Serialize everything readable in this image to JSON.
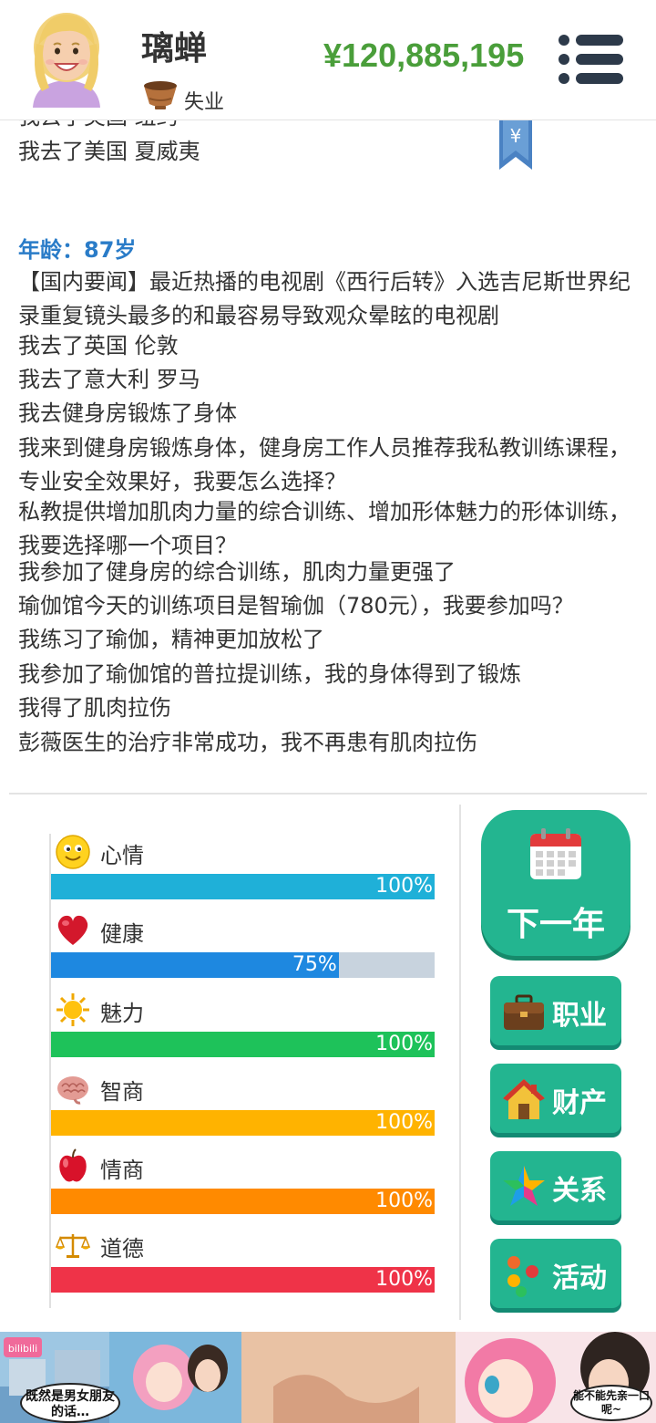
{
  "header": {
    "name": "璃蝉",
    "job": "失业",
    "money": "¥120,885,195"
  },
  "log": {
    "cut_line": "我去了美国 纽约",
    "top_line": "我去了美国 夏威夷",
    "age": "年龄：87岁",
    "entries": [
      "【国内要闻】最近热播的电视剧《西行后转》入选吉尼斯世界纪录重复镜头最多的和最容易导致观众晕眩的电视剧",
      "我去了英国 伦敦",
      "我去了意大利 罗马",
      "我去健身房锻炼了身体",
      "我来到健身房锻炼身体，健身房工作人员推荐我私教训练课程，专业安全效果好，我要怎么选择？",
      "私教提供增加肌肉力量的综合训练、增加形体魅力的形体训练，我要选择哪一个项目？",
      "我参加了健身房的综合训练，肌肉力量更强了",
      "瑜伽馆今天的训练项目是智瑜伽（780元），我要参加吗？",
      "我练习了瑜伽，精神更加放松了",
      "我参加了瑜伽馆的普拉提训练，我的身体得到了锻炼",
      "我得了肌肉拉伤",
      "彭薇医生的治疗非常成功，我不再患有肌肉拉伤"
    ]
  },
  "stats": [
    {
      "label": "心情",
      "value": 100,
      "text": "100%",
      "color": "#1fb0d8",
      "icon": "smiley-icon"
    },
    {
      "label": "健康",
      "value": 75,
      "text": "75%",
      "color": "#1e88e0",
      "icon": "heart-icon"
    },
    {
      "label": "魅力",
      "value": 100,
      "text": "100%",
      "color": "#1ec25a",
      "icon": "sun-icon"
    },
    {
      "label": "智商",
      "value": 100,
      "text": "100%",
      "color": "#ffb300",
      "icon": "brain-icon"
    },
    {
      "label": "情商",
      "value": 100,
      "text": "100%",
      "color": "#ff8a00",
      "icon": "apple-icon"
    },
    {
      "label": "道德",
      "value": 100,
      "text": "100%",
      "color": "#ef3348",
      "icon": "scales-icon"
    }
  ],
  "buttons": {
    "next_year": "下一年",
    "career": "职业",
    "property": "财产",
    "relations": "关系",
    "activity": "活动"
  },
  "ad": {
    "logo": "bilibili",
    "bubble_left": "既然是男女朋友的话…",
    "bubble_right": "能不能先亲一口呢~"
  }
}
